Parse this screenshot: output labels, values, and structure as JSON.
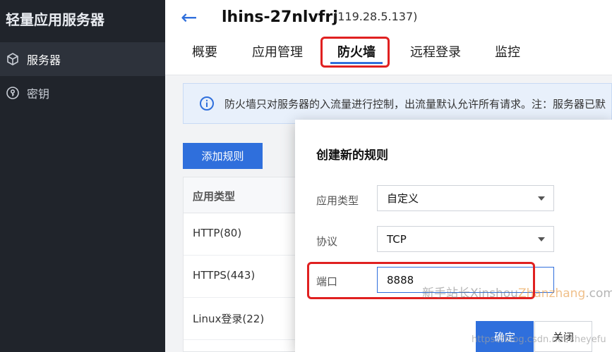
{
  "sidebar": {
    "title": "轻量应用服务器",
    "items": [
      {
        "label": "服务器",
        "icon": "cube-icon"
      },
      {
        "label": "密钥",
        "icon": "key-icon"
      }
    ]
  },
  "header": {
    "instance_name": "lhins-27nlvfrj",
    "instance_ip": "(119.28.5.137)",
    "tabs": [
      {
        "label": "概要"
      },
      {
        "label": "应用管理"
      },
      {
        "label": "防火墙"
      },
      {
        "label": "远程登录"
      },
      {
        "label": "监控"
      }
    ]
  },
  "banner": {
    "text": "防火墙只对服务器的入流量进行控制，出流量默认允许所有请求。注：服务器已默"
  },
  "toolbar": {
    "add_rule_label": "添加规则"
  },
  "table": {
    "header": "应用类型",
    "rows": [
      "HTTP(80)",
      "HTTPS(443)",
      "Linux登录(22)"
    ]
  },
  "modal": {
    "title": "创建新的规则",
    "app_type_label": "应用类型",
    "app_type_value": "自定义",
    "protocol_label": "协议",
    "protocol_value": "TCP",
    "port_label": "端口",
    "port_value": "8888",
    "ok_label": "确定",
    "close_label": "关闭"
  },
  "watermark": {
    "text_a": "新手站长Xinshou",
    "text_b": "Zhanzhang",
    "text_c": ".com",
    "url": "https://blog.csdn.net/sheyefu"
  },
  "colors": {
    "accent": "#2f6fdc",
    "highlight": "#e02020",
    "sidebar_bg": "#20242b"
  }
}
